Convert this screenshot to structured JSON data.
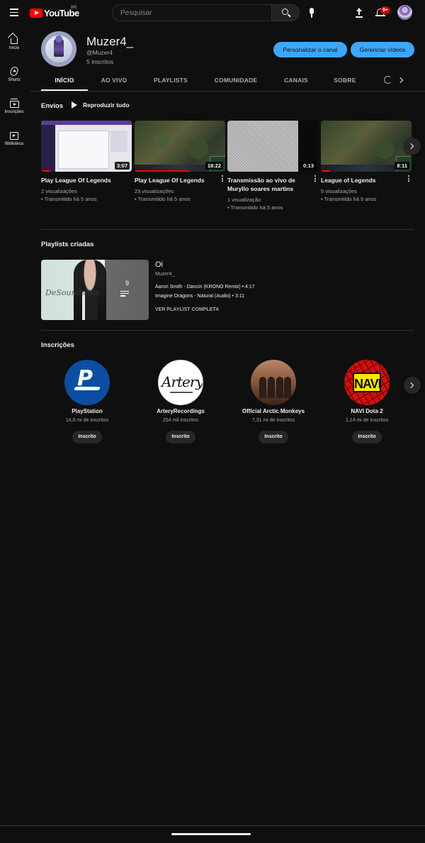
{
  "header": {
    "logo_text": "YouTube",
    "country_code": "BR",
    "search_placeholder": "Pesquisar",
    "notifications_badge": "9+"
  },
  "sidebar": {
    "items": [
      {
        "label": "Início",
        "icon": "home-icon"
      },
      {
        "label": "Shorts",
        "icon": "shorts-icon"
      },
      {
        "label": "Inscrições",
        "icon": "subscriptions-icon"
      },
      {
        "label": "Biblioteca",
        "icon": "library-icon"
      }
    ]
  },
  "channel": {
    "name": "Muzer4_",
    "handle": "@Muzer4",
    "subscribers": "5 inscritos",
    "customize_label": "Personalizar o canal",
    "manage_label": "Gerenciar vídeos"
  },
  "tabs": [
    {
      "label": "INÍCIO",
      "active": true
    },
    {
      "label": "AO VIVO",
      "active": false
    },
    {
      "label": "PLAYLISTS",
      "active": false
    },
    {
      "label": "COMUNIDADE",
      "active": false
    },
    {
      "label": "CANAIS",
      "active": false
    },
    {
      "label": "SOBRE",
      "active": false
    }
  ],
  "uploads": {
    "title": "Envios",
    "play_all": "Reproduzir tudo",
    "videos": [
      {
        "title": "Play League Of Legends",
        "duration": "3:07",
        "views": "2 visualizações",
        "when": "• Transmitido há 5 anos",
        "progress": 0.1
      },
      {
        "title": "Play League Of Legends",
        "duration": "18:22",
        "views": "23 visualizações",
        "when": "• Transmitido há 5 anos",
        "progress": 0.6
      },
      {
        "title": "Transmissão ao vivo de Muryllo soares martins",
        "duration": "0:13",
        "views": "1 visualização",
        "when": "• Transmitido há 5 anos",
        "progress": 0
      },
      {
        "title": "League of Legends",
        "duration": "8:11",
        "views": "5 visualizações",
        "when": "• Transmitido há 5 anos",
        "progress": 0.1
      }
    ]
  },
  "playlists": {
    "title": "Playlists criadas",
    "playlist": {
      "name": "Oi",
      "owner": "Muzer4_",
      "count": "9",
      "items": [
        "Aaron Smith - Dancin (KRONO Remix) • 4:17",
        "Imagine Dragons - Natural (Audio) • 3:11"
      ],
      "view_full": "VER PLAYLIST COMPLETA"
    }
  },
  "subscriptions": {
    "title": "Inscrições",
    "channels": [
      {
        "name": "PlayStation",
        "count": "14,6 mi de inscritos",
        "button": "Inscrito"
      },
      {
        "name": "ArteryRecordings",
        "count": "254 mil inscritos",
        "button": "Inscrito"
      },
      {
        "name": "Official Arctic Monkeys",
        "count": "7,31 mi de inscritos",
        "button": "Inscrito"
      },
      {
        "name": "NAVI Dota 2",
        "count": "1,14 mi de inscritos",
        "button": "Inscrito"
      }
    ]
  },
  "colors": {
    "background": "#0f0f0f",
    "accent_blue": "#3ea6ff",
    "brand_red": "#ff0000"
  }
}
